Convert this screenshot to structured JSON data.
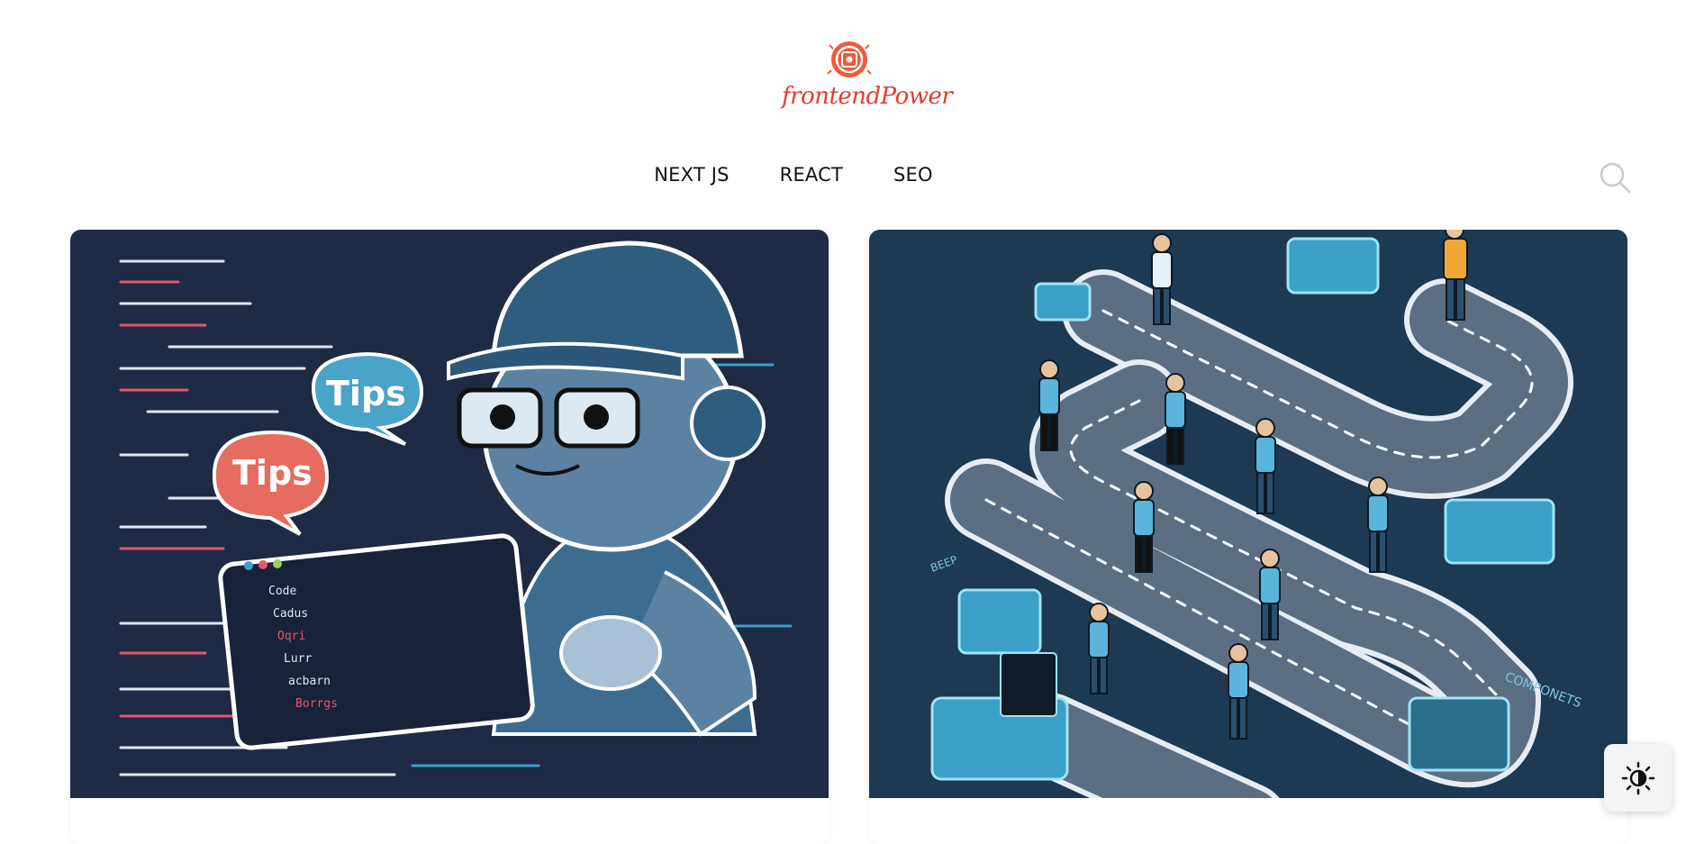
{
  "brand": {
    "name": "frontendPower",
    "logo_icon": "chip-gear-logo",
    "accent": "#e63b2e"
  },
  "nav": {
    "items": [
      "NEXT JS",
      "REACT",
      "SEO"
    ]
  },
  "search": {
    "icon": "search-icon"
  },
  "cards": [
    {
      "image": "robot-tips-illustration",
      "bubble_1": "Tips",
      "bubble_2": "Tips",
      "screen_lines": [
        "Code",
        "Cadus",
        "Oqri",
        "Lurr",
        "acbarn",
        "Borrgs"
      ]
    },
    {
      "image": "isometric-roadmap-illustration",
      "label": "COMPONETS",
      "side_label": "BEEP"
    }
  ],
  "theme_toggle": {
    "icon": "contrast-icon"
  },
  "colors": {
    "card1_bg": "#1f2a44",
    "card2_bg": "#1d3a52",
    "accent_blue": "#3aa0c8",
    "accent_coral": "#e56c5f"
  }
}
